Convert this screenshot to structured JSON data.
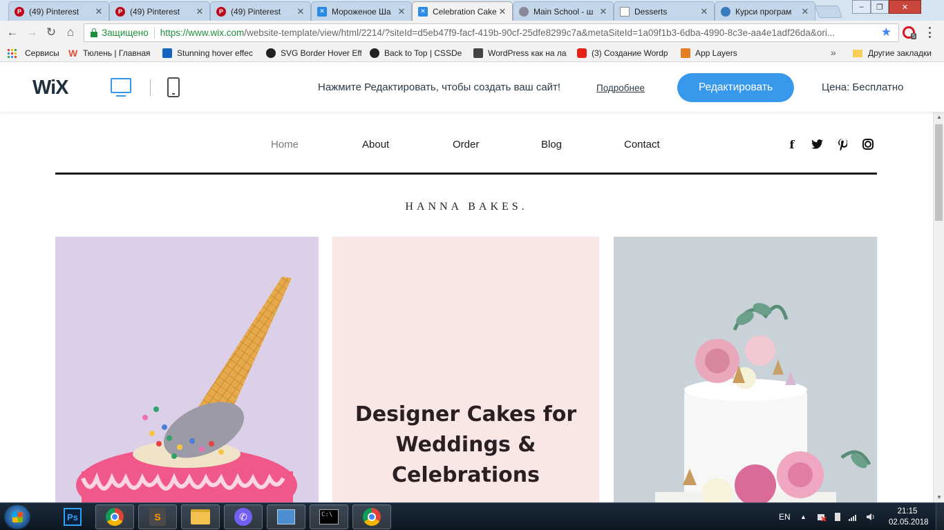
{
  "browser": {
    "tabs": [
      {
        "title": "(49) Pinterest",
        "icon": "pinterest-icon"
      },
      {
        "title": "(49) Pinterest",
        "icon": "pinterest-icon"
      },
      {
        "title": "(49) Pinterest",
        "icon": "pinterest-icon"
      },
      {
        "title": "Мороженое Ша",
        "icon": "wix-icon"
      },
      {
        "title": "Celebration Cake",
        "icon": "wix-icon"
      },
      {
        "title": "Main School - ш",
        "icon": "school-icon"
      },
      {
        "title": "Desserts",
        "icon": "document-icon"
      },
      {
        "title": "Курси програм",
        "icon": "globe-icon"
      }
    ],
    "active_tab": 4,
    "window_controls": {
      "minimize": "‒",
      "maximize": "❐",
      "close": "✕"
    },
    "address": {
      "secure_label": "Защищено",
      "url_host": "https://www.wix.com",
      "url_rest": "/website-template/view/html/2214/?siteId=d5eb47f9-facf-419b-90cf-25dfe8299c7a&metaSiteId=1a09f1b3-6dba-4990-8c3e-aa4e1adf26da&ori...",
      "extension_badge": "5"
    },
    "bookmarks": [
      {
        "label": "Сервисы",
        "icon": "apps-icon"
      },
      {
        "label": "Тюлень | Главная",
        "icon": "w-icon",
        "color": "#e34b3b"
      },
      {
        "label": "Stunning hover effec",
        "icon": "p-icon",
        "color": "#1565c0"
      },
      {
        "label": "SVG Border Hover Eff",
        "icon": "spinner-icon",
        "color": "#222222"
      },
      {
        "label": "Back to Top | CSSDe",
        "icon": "spinner-icon",
        "color": "#222222"
      },
      {
        "label": "WordPress как на ла",
        "icon": "wp-icon",
        "color": "#444444"
      },
      {
        "label": "(3) Создание Wordp",
        "icon": "youtube-icon",
        "color": "#e62117"
      },
      {
        "label": "App Layers",
        "icon": "layers-icon",
        "color": "#e67e22"
      }
    ],
    "bookmarks_more": "»",
    "other_bookmarks": "Другие закладки"
  },
  "wix_bar": {
    "logo": "WiX",
    "message": "Нажмите Редактировать, чтобы создать ваш сайт!",
    "learn_more": "Подробнее",
    "edit_button": "Редактировать",
    "price": "Цена: Бесплатно"
  },
  "site": {
    "nav": [
      "Home",
      "About",
      "Order",
      "Blog",
      "Contact"
    ],
    "current_nav": "Home",
    "social": [
      {
        "name": "facebook-icon",
        "glyph": "f"
      },
      {
        "name": "twitter-icon",
        "glyph": "t"
      },
      {
        "name": "pinterest-icon",
        "glyph": "p"
      },
      {
        "name": "instagram-icon",
        "glyph": ""
      }
    ],
    "brand": "HANNA BAKES.",
    "headline_lines": [
      "Designer Cakes for",
      "Weddings &",
      "Celebrations"
    ],
    "colors": {
      "left_panel": "#dccfe8",
      "middle_panel": "#f8e7e4",
      "right_panel": "#c8d2d8",
      "accent_blue": "#3899ec"
    }
  },
  "taskbar": {
    "apps": [
      "photoshop",
      "chrome",
      "sublime-text",
      "file-explorer",
      "viber",
      "control-panel",
      "command-prompt",
      "chrome"
    ],
    "language": "EN",
    "time": "21:15",
    "date": "02.05.2018"
  }
}
